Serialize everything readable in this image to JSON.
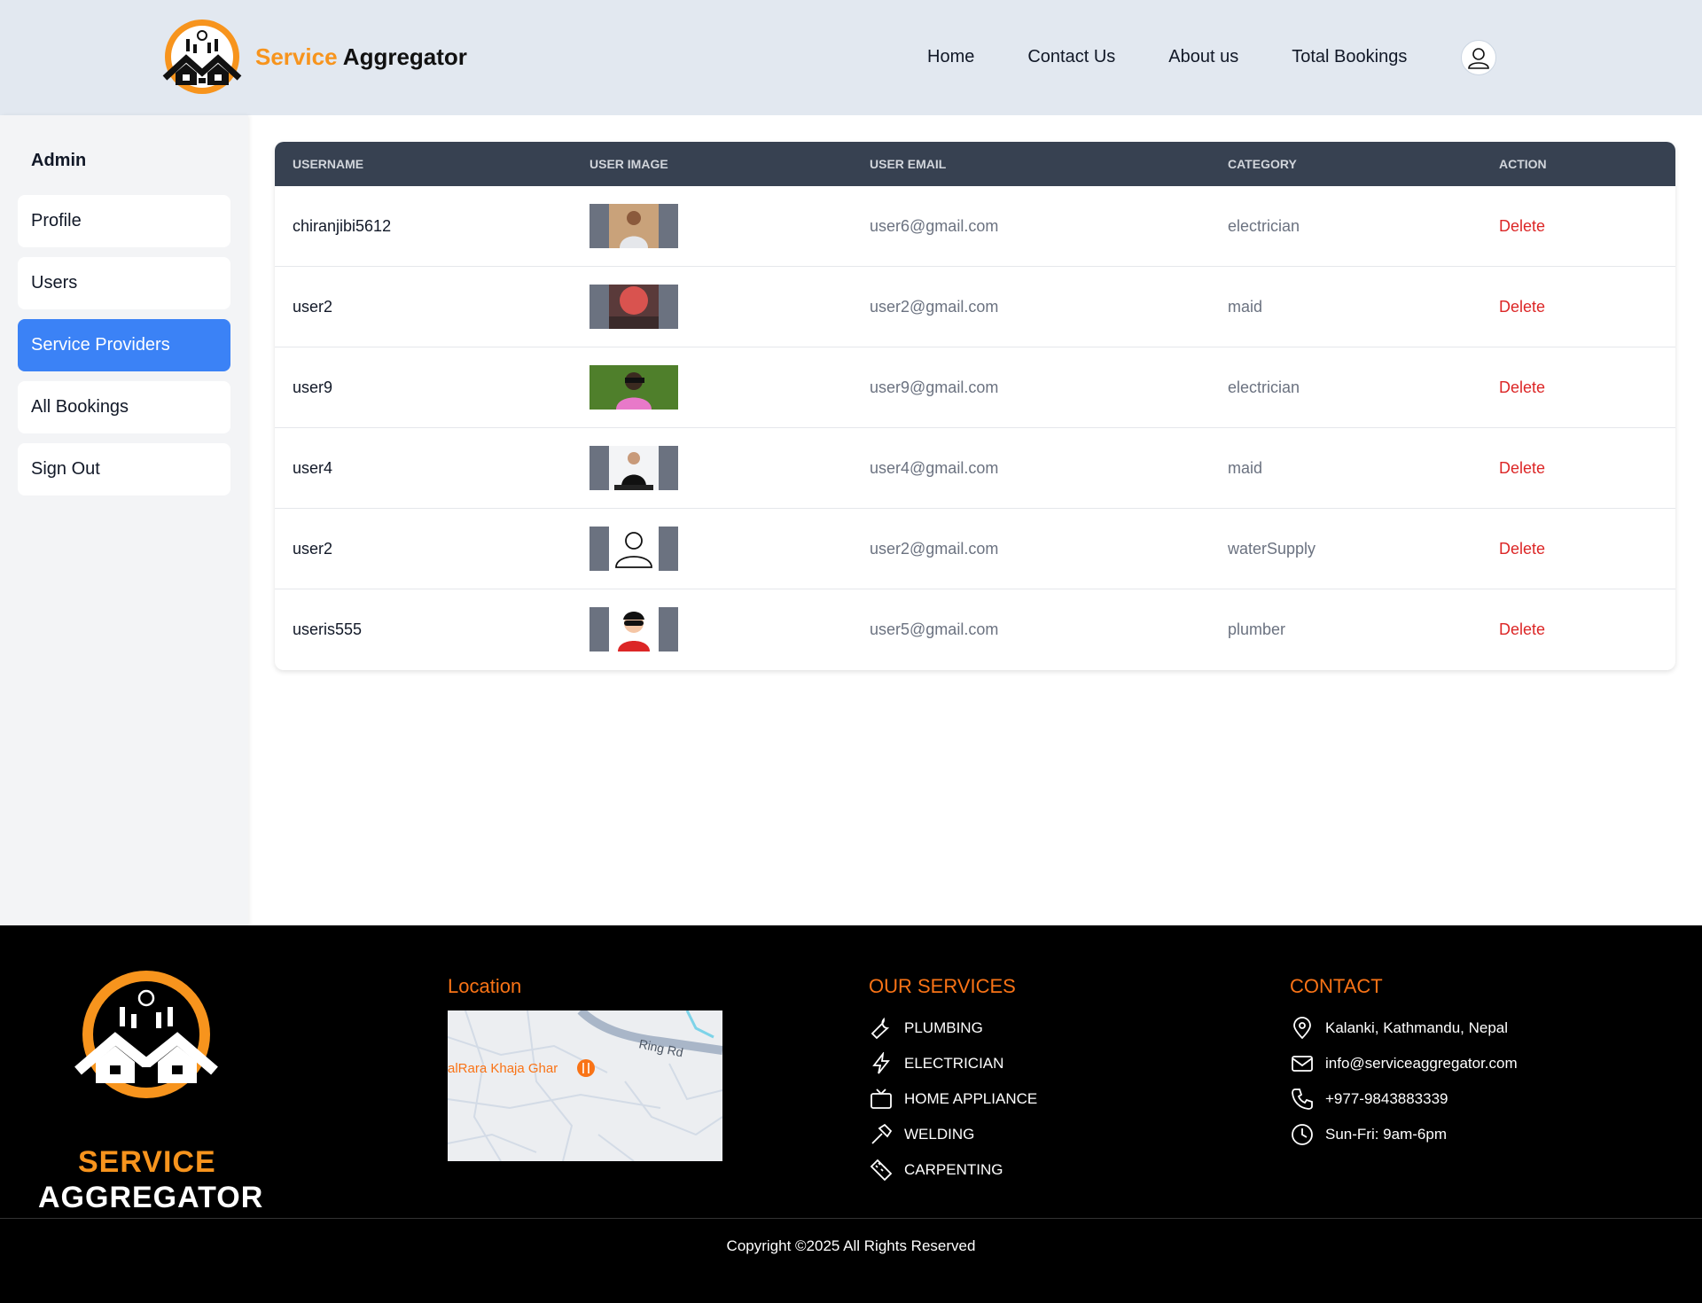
{
  "header": {
    "brand_part1": "Service",
    "brand_part2": "Aggregator",
    "nav": [
      "Home",
      "Contact Us",
      "About us",
      "Total Bookings"
    ]
  },
  "sidebar": {
    "title": "Admin",
    "items": [
      {
        "label": "Profile",
        "active": false
      },
      {
        "label": "Users",
        "active": false
      },
      {
        "label": "Service Providers",
        "active": true
      },
      {
        "label": "All Bookings",
        "active": false
      },
      {
        "label": "Sign Out",
        "active": false
      }
    ]
  },
  "table": {
    "columns": [
      "USERNAME",
      "USER IMAGE",
      "USER EMAIL",
      "CATEGORY",
      "ACTION"
    ],
    "rows": [
      {
        "username": "chiranjibi5612",
        "email": "user6@gmail.com",
        "category": "electrician",
        "action": "Delete"
      },
      {
        "username": "user2",
        "email": "user2@gmail.com",
        "category": "maid",
        "action": "Delete"
      },
      {
        "username": "user9",
        "email": "user9@gmail.com",
        "category": "electrician",
        "action": "Delete"
      },
      {
        "username": "user4",
        "email": "user4@gmail.com",
        "category": "maid",
        "action": "Delete"
      },
      {
        "username": "user2",
        "email": "user2@gmail.com",
        "category": "waterSupply",
        "action": "Delete"
      },
      {
        "username": "useris555",
        "email": "user5@gmail.com",
        "category": "plumber",
        "action": "Delete"
      }
    ]
  },
  "footer": {
    "logo_line1": "SERVICE",
    "logo_line2": "AGGREGATOR",
    "location_heading": "Location",
    "map_labels": {
      "road": "Ring Rd",
      "place": "alRara Khaja Ghar"
    },
    "services_heading": "OUR SERVICES",
    "services": [
      "PLUMBING",
      "ELECTRICIAN",
      "HOME APPLIANCE",
      "WELDING",
      "CARPENTING"
    ],
    "contact_heading": "CONTACT",
    "contact": [
      "Kalanki, Kathmandu, Nepal",
      "info@serviceaggregator.com",
      "+977-9843883339",
      "Sun-Fri: 9am-6pm"
    ],
    "copyright": "Copyright ©2025 All Rights Reserved"
  },
  "colors": {
    "accent": "#3b82f6",
    "brand_orange": "#f7941d",
    "delete_red": "#dc2626",
    "header_bg": "#e2e8f0",
    "table_head_bg": "#374151"
  }
}
